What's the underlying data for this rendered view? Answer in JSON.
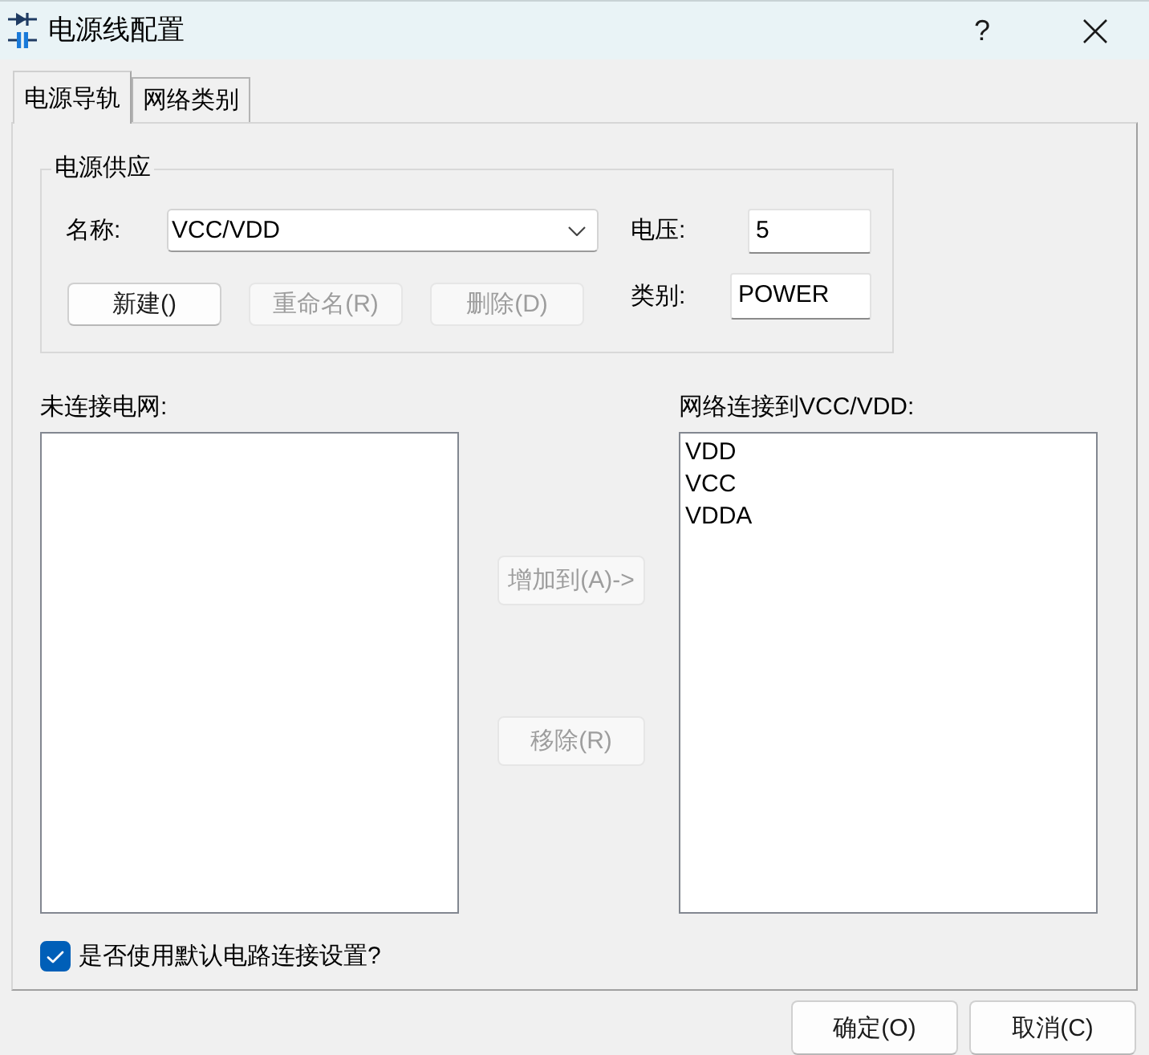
{
  "window": {
    "title": "电源线配置",
    "help_button": "?"
  },
  "tabs": [
    {
      "label": "电源导轨",
      "selected": true
    },
    {
      "label": "网络类别",
      "selected": false
    }
  ],
  "power_supply": {
    "title": "电源供应",
    "name_label": "名称:",
    "name_value": "VCC/VDD",
    "voltage_label": "电压:",
    "voltage_value": "5",
    "class_label": "类别:",
    "class_value": "POWER",
    "buttons": [
      {
        "label": "新建()",
        "disabled": false
      },
      {
        "label": "重命名(R)",
        "disabled": true
      },
      {
        "label": "删除(D)",
        "disabled": true
      }
    ]
  },
  "unconnected_nets": {
    "label": "未连接电网:"
  },
  "transfer_buttons": [
    {
      "label": "增加到(A)->",
      "disabled": true
    },
    {
      "label": "移除(R)",
      "disabled": true
    }
  ],
  "connected_nets": {
    "label": "网络连接到VCC/VDD:",
    "items": [
      {
        "label": "VDD",
        "selected": false
      },
      {
        "label": "VCC",
        "selected": false
      },
      {
        "label": "VDDA",
        "selected": false
      }
    ]
  },
  "default_connection": {
    "label": "是否使用默认电路连接设置?",
    "checked": true
  },
  "dialog_buttons": [
    {
      "label": "确定(O)"
    },
    {
      "label": "取消(C)"
    }
  ]
}
